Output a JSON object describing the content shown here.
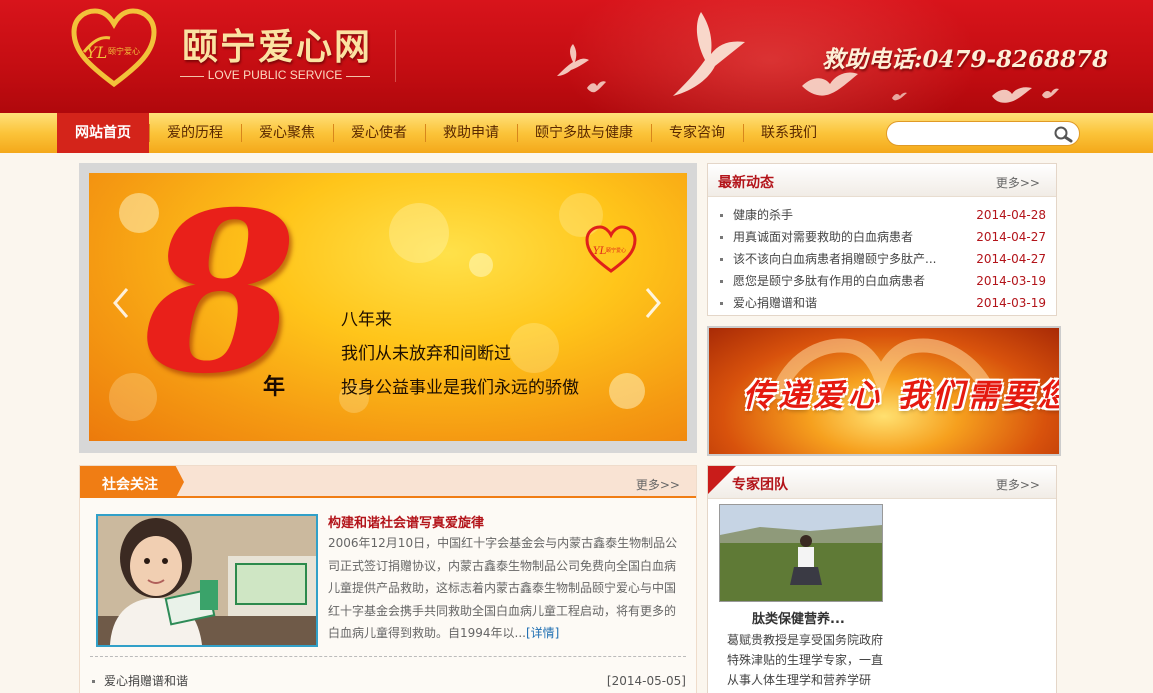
{
  "header": {
    "site_title": "颐宁爱心网",
    "site_subtitle": "LOVE PUBLIC SERVICE",
    "hotline": "救助电话:0479-8268878",
    "logo_icon": "heart-logo-icon",
    "colors": {
      "primary_red": "#c40d12",
      "gold": "#fbc43a",
      "text_red": "#b3141a"
    }
  },
  "nav": {
    "items": [
      {
        "label": "网站首页",
        "active": true
      },
      {
        "label": "爱的历程"
      },
      {
        "label": "爱心聚焦"
      },
      {
        "label": "爱心使者"
      },
      {
        "label": "救助申请"
      },
      {
        "label": "颐宁多肽与健康"
      },
      {
        "label": "专家咨询"
      },
      {
        "label": "联系我们"
      }
    ],
    "search_placeholder": "",
    "search_icon": "magnifier-icon"
  },
  "banner": {
    "big_number": "8",
    "unit": "年",
    "lines": [
      "八年来",
      "我们从未放弃和间断过",
      "投身公益事业是我们永远的骄傲"
    ]
  },
  "news": {
    "title": "最新动态",
    "more": "更多>>",
    "items": [
      {
        "title": "健康的杀手",
        "date": "2014-04-28"
      },
      {
        "title": "用真诚面对需要救助的白血病患者",
        "date": "2014-04-27"
      },
      {
        "title": "该不该向白血病患者捐赠颐宁多肽产...",
        "date": "2014-04-27"
      },
      {
        "title": "愿您是颐宁多肽有作用的白血病患者",
        "date": "2014-03-19"
      },
      {
        "title": "爱心捐赠谱和谐",
        "date": "2014-03-19"
      }
    ]
  },
  "ad": {
    "text": "传递爱心 我们需要您"
  },
  "social": {
    "title": "社会关注",
    "more": "更多>>",
    "article_title": "构建和谐社会谱写真爱旋律",
    "article_body": "2006年12月10日，中国红十字会基金会与内蒙古鑫泰生物制品公司正式签订捐赠协议，内蒙古鑫泰生物制品公司免费向全国白血病儿童提供产品救助，这标志着内蒙古鑫泰生物制品颐宁爱心与中国红十字基金会携手共同救助全国白血病儿童工程启动，将有更多的白血病儿童得到救助。自1994年以...",
    "detail_link": "[详情]",
    "list": [
      {
        "title": "爱心捐赠谱和谐",
        "date": "[2014-05-05]"
      }
    ]
  },
  "experts": {
    "title": "专家团队",
    "more": "更多>>",
    "name": "肽类保健营养...",
    "desc": "葛赋贵教授是享受国务院政府特殊津贴的生理学专家，一直从事人体生理学和营养学研"
  }
}
